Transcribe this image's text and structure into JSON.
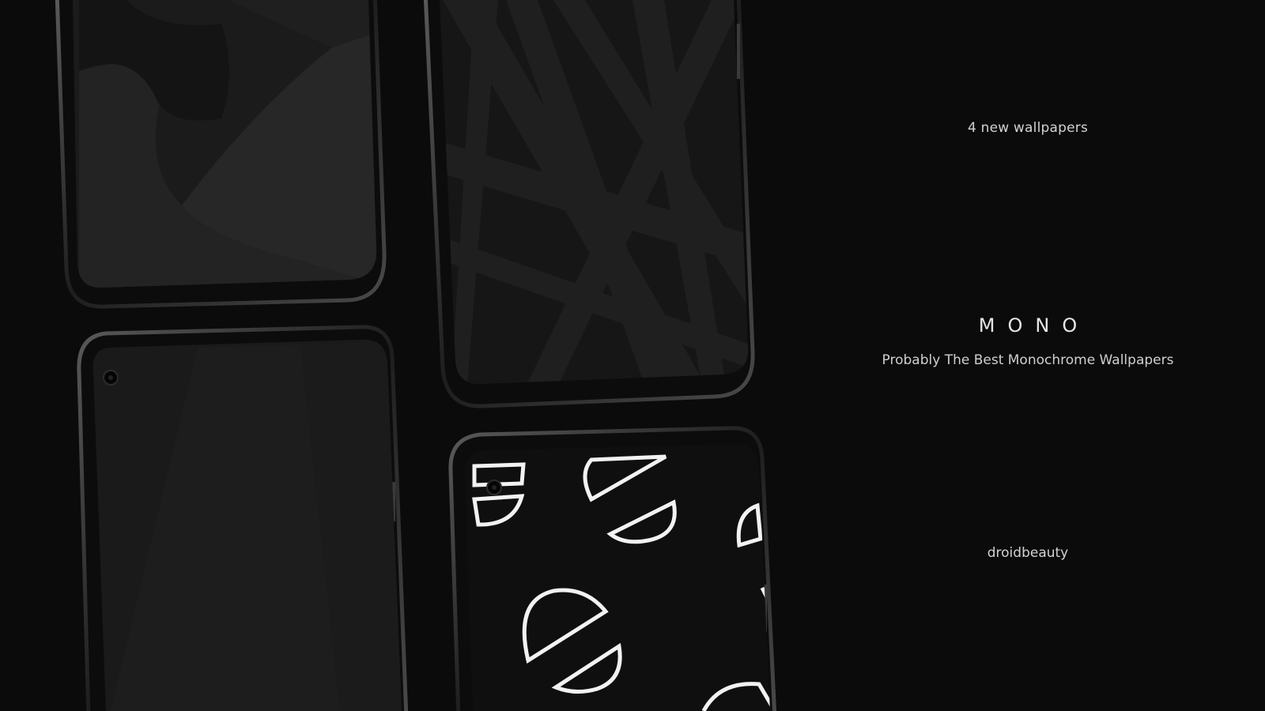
{
  "hero": {
    "count_label": "4 new wallpapers",
    "brand": "MONO",
    "tagline": "Probably The Best Monochrome Wallpapers",
    "author": "droidbeauty"
  },
  "phones": [
    {
      "wallpaper": "dark-abstract-waves"
    },
    {
      "wallpaper": "dark-crossing-lines"
    },
    {
      "wallpaper": "dark-diagonal-gradient"
    },
    {
      "wallpaper": "white-half-circles"
    }
  ],
  "colors": {
    "background": "#0b0b0b",
    "text": "#d8d8d8",
    "accent": "#ffffff"
  }
}
